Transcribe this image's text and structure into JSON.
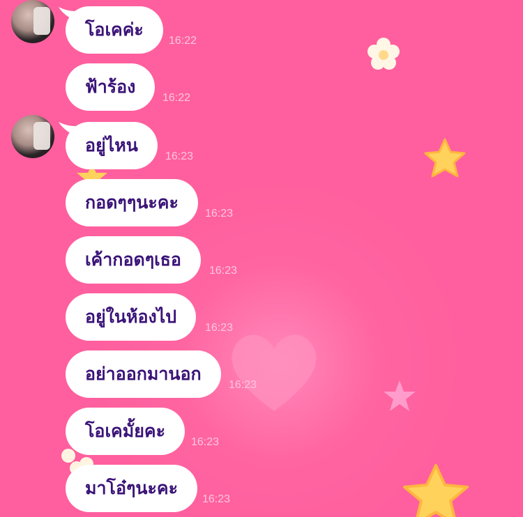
{
  "messages": [
    {
      "text": "โอเคค่ะ",
      "time": "16:22"
    },
    {
      "text": "ฟ้าร้อง",
      "time": "16:22"
    },
    {
      "text": "อยู่ไหน",
      "time": "16:23"
    },
    {
      "text": "กอดๆๆนะคะ",
      "time": "16:23"
    },
    {
      "text": "เค้ากอดๆเธอ",
      "time": "16:23"
    },
    {
      "text": "อยู่ในห้องไป",
      "time": "16:23"
    },
    {
      "text": "อย่าออกมานอก",
      "time": "16:23"
    },
    {
      "text": "โอเคมั้ยคะ",
      "time": "16:23"
    },
    {
      "text": "มาโอ๋ๆนะคะ",
      "time": "16:23"
    }
  ],
  "decorations": [
    "flower-icon",
    "star-icon",
    "heart-icon"
  ],
  "colors": {
    "background": "#ff5f9e",
    "bubble": "#ffffff",
    "text": "#3a1378",
    "timestamp": "#ffc7df"
  }
}
